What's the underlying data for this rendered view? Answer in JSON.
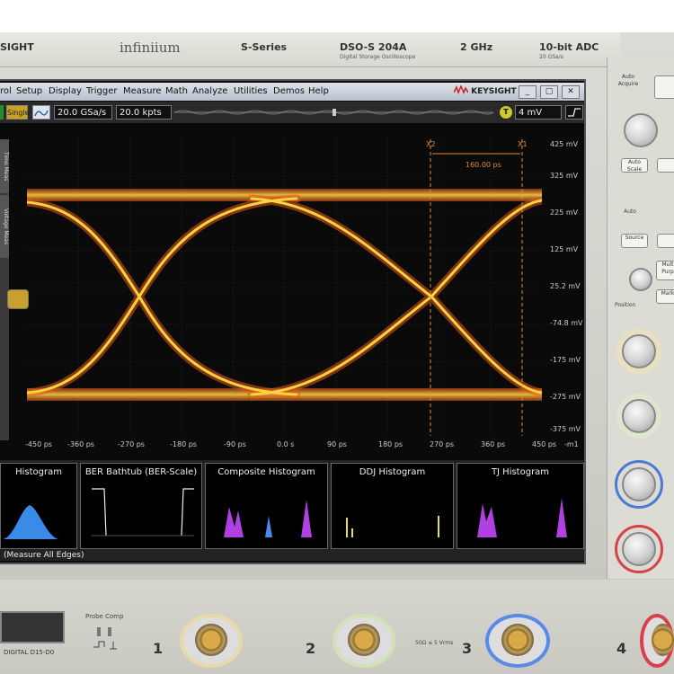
{
  "header": {
    "brand": "SIGHT",
    "product": "infiniium",
    "series": "S-Series",
    "model": "DSO-S 204A",
    "model_sub": "Digital Storage Oscilloscope",
    "bandwidth": "2 GHz",
    "adc": "10-bit ADC",
    "adc_sub": "20 GSa/s"
  },
  "menu": {
    "items": [
      "rol",
      "Setup",
      "Display",
      "Trigger",
      "Measure",
      "Math",
      "Analyze",
      "Utilities",
      "Demos",
      "Help"
    ],
    "logo": "KEYSIGHT"
  },
  "toolbar": {
    "single_label": "Single",
    "sample_rate": "20.0 GSa/s",
    "memory_depth": "20.0 kpts",
    "trigger_level": "4 mV",
    "trigger_badge": "T"
  },
  "side_tabs": [
    "Time Meas",
    "Voltage Meas"
  ],
  "plot": {
    "y_labels": [
      "425 mV",
      "325 mV",
      "225 mV",
      "125 mV",
      "25.2 mV",
      "-74.8 mV",
      "-175 mV",
      "-275 mV",
      "-375 mV"
    ],
    "x_labels": [
      "-450 ps",
      "-360 ps",
      "-270 ps",
      "-180 ps",
      "-90 ps",
      "0.0 s",
      "90 ps",
      "180 ps",
      "270 ps",
      "360 ps",
      "450 ps"
    ],
    "x_unit_suffix": "-m1",
    "marker_x2": "X2",
    "marker_x1": "X1",
    "marker_delta": "160.00 ps"
  },
  "panels": [
    {
      "title": "Histogram"
    },
    {
      "title": "BER Bathtub (BER-Scale)"
    },
    {
      "title": "Composite Histogram"
    },
    {
      "title": "DDJ Histogram"
    },
    {
      "title": "TJ Histogram"
    }
  ],
  "measure_all": "(Measure All Edges)",
  "right_panel": {
    "auto_scale": "Auto Scale",
    "auto_label": "Auto",
    "top_key": "Auto Acquire",
    "source": "Source",
    "position": "Position",
    "multi": "Mult Purp",
    "mark": "Mark"
  },
  "front": {
    "digital": "DIGITAL D15-D0",
    "probe_comp": "Probe Comp",
    "channels": [
      "1",
      "2",
      "3",
      "4"
    ],
    "rating": "50Ω ≤ 5 Vrms"
  },
  "colors": {
    "ch1": "#e8c33a",
    "ch2": "#8ab34a",
    "ch3": "#4a7ad8",
    "ch4": "#d8404a",
    "eye_core": "#ffd040",
    "eye_edge": "#e05a1a"
  }
}
